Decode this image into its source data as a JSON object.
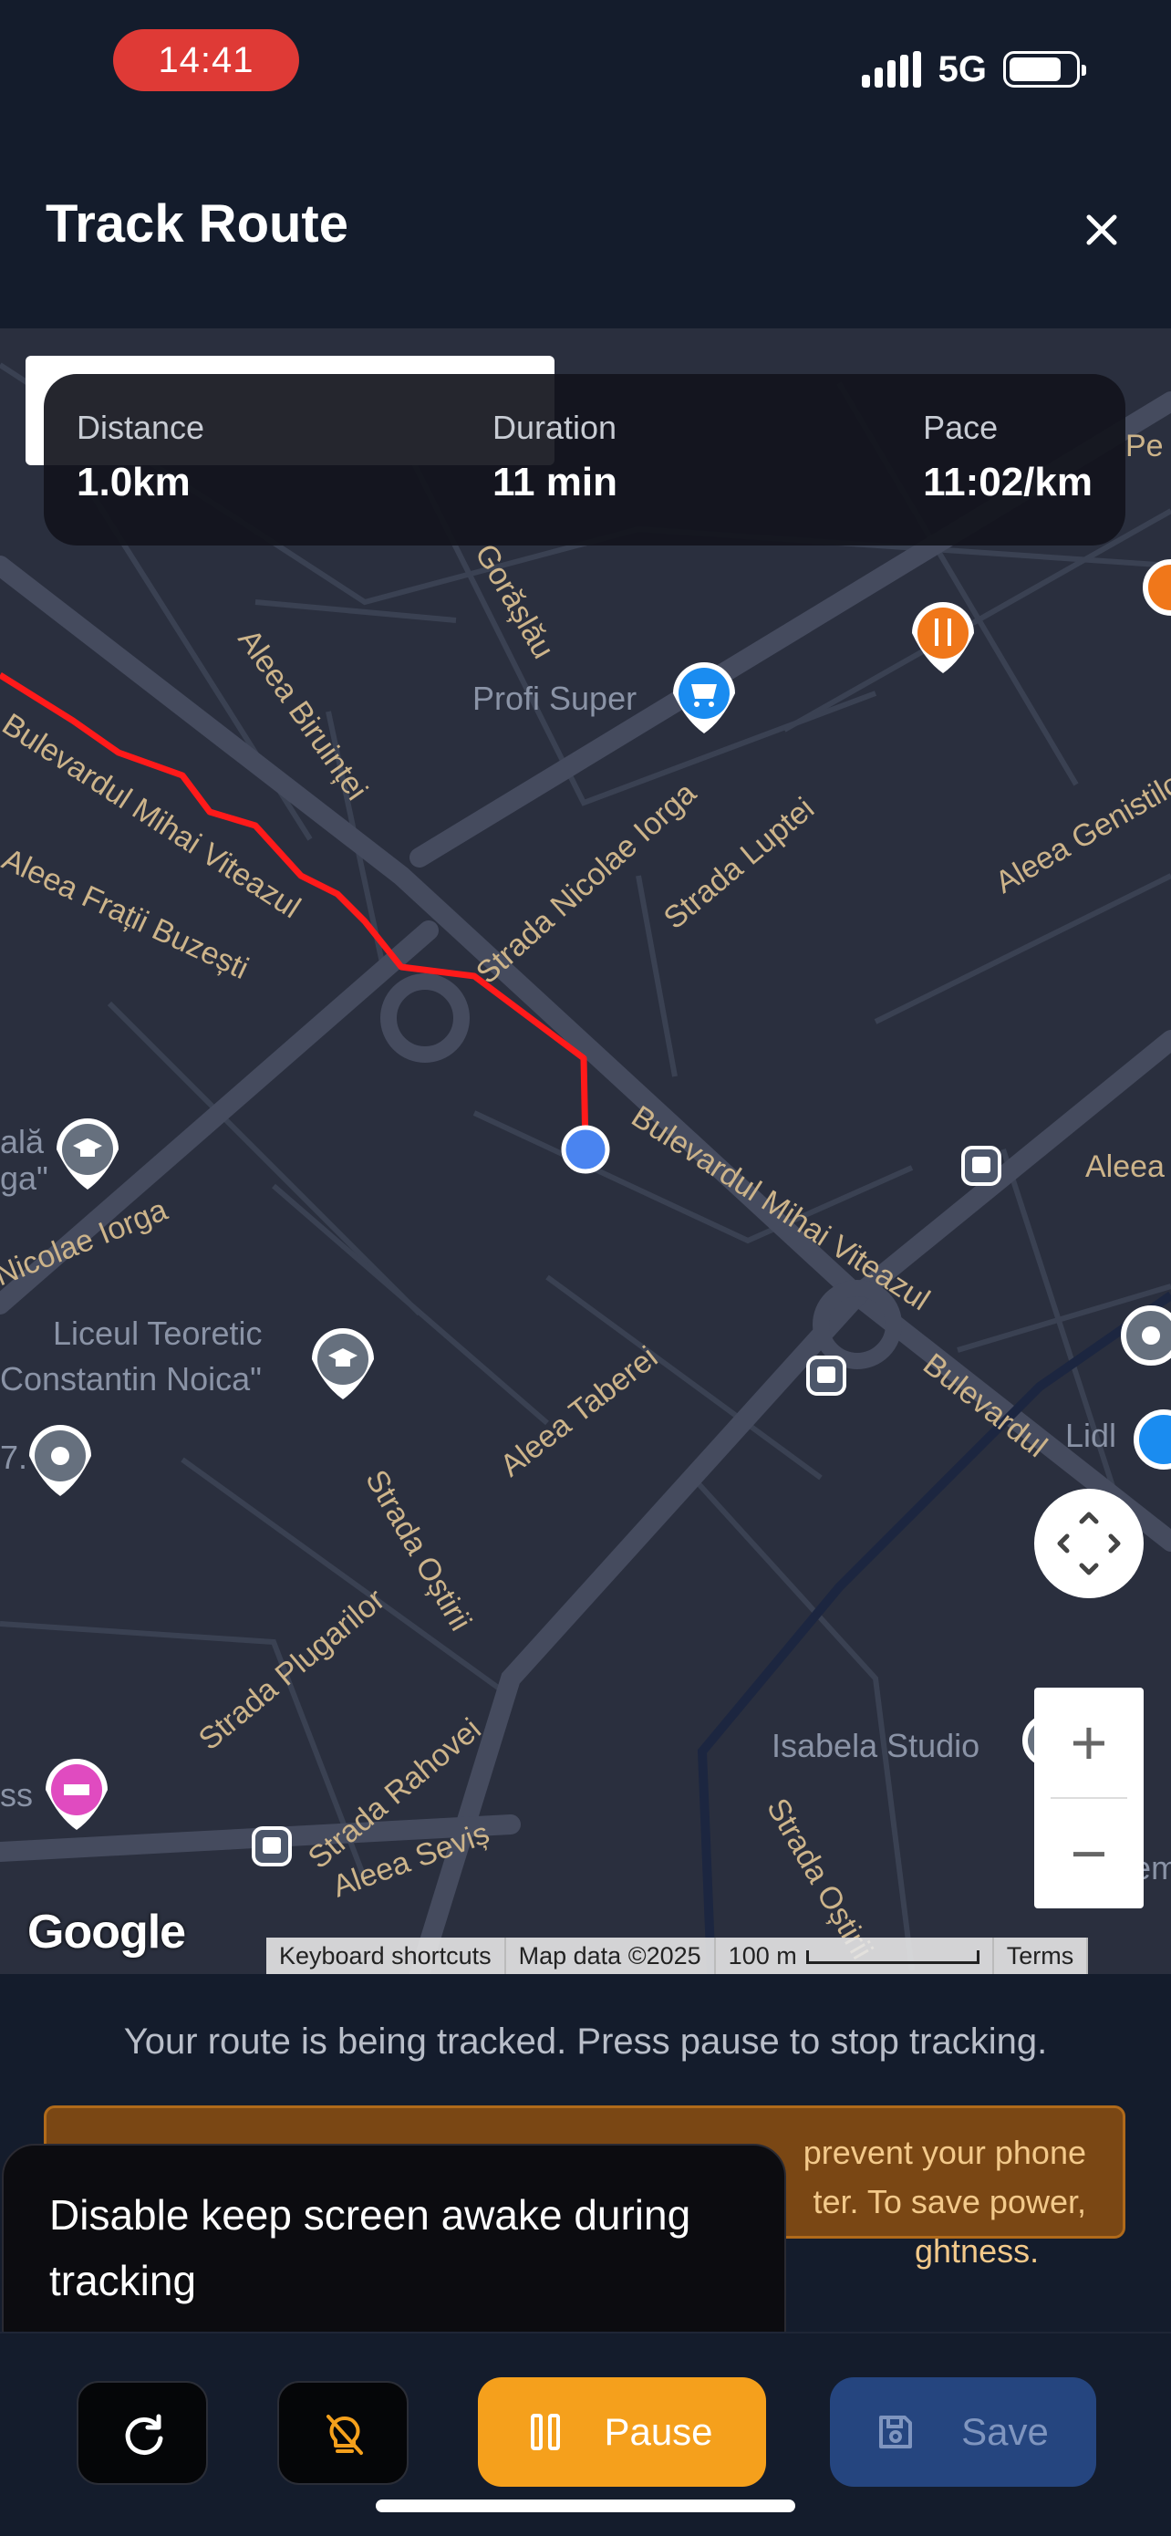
{
  "status_bar": {
    "time": "14:41",
    "network": "5G"
  },
  "header": {
    "title": "Track Route",
    "close_icon": "close-icon"
  },
  "map": {
    "stats": [
      {
        "label": "Distance",
        "value": "1.0km"
      },
      {
        "label": "Duration",
        "value": "11 min"
      },
      {
        "label": "Pace",
        "value": "11:02/km"
      }
    ],
    "street_labels": [
      "Bulevardul Mihai Viteazul",
      "Bulevardul Mihai Viteazul",
      "Bulevardul",
      "Strada Nicolae Iorga",
      "Nicolae Iorga",
      "Strada Luptei",
      "Aleea Biruinței",
      "Aleea Frații Buzești",
      "Gorășlău",
      "Aleea Genistilor",
      "Aleea Taberei",
      "Strada Oștirii",
      "Strada Plugarilor",
      "Strada Rahovei",
      "Aleea Seviș",
      "Strada Oștirii",
      "Aleea",
      "Pe"
    ],
    "place_labels": [
      "Profi Super",
      "Liceul Teoretic",
      "Constantin Noica\"",
      "Isabela Studio",
      "Lidl",
      "Dedeman",
      "ală",
      "ga\"",
      "ss",
      "7."
    ],
    "route_color": "#ff1a1a",
    "location_color": "#4a84f0",
    "google_logo": "Google",
    "attribution": [
      "Keyboard shortcuts",
      "Map data ©2025",
      "100 m",
      "Terms"
    ],
    "controls": {
      "recenter_icon": "recenter-icon",
      "zoom_in": "+",
      "zoom_out": "−"
    }
  },
  "tracking_message": "Your route is being tracked. Press pause to stop tracking.",
  "warning": {
    "line1": "Keep Screen Awake is enabled. This will prevent your phone",
    "line2": "from sleeping and drain battery faster. To save power,",
    "line3": "reduce screen brightness.",
    "visible_fragments": [
      "prevent your phone",
      "ter. To save power,",
      "ghtness."
    ]
  },
  "toast": {
    "text": "Disable keep screen awake during tracking"
  },
  "actions": {
    "reset_icon": "refresh-icon",
    "awake_icon": "lightbulb-off-icon",
    "pause_label": "Pause",
    "save_label": "Save"
  },
  "colors": {
    "background": "#141c2c",
    "pause": "#f5a01c",
    "save": "#25457f",
    "warning_bg": "#7a4714"
  }
}
